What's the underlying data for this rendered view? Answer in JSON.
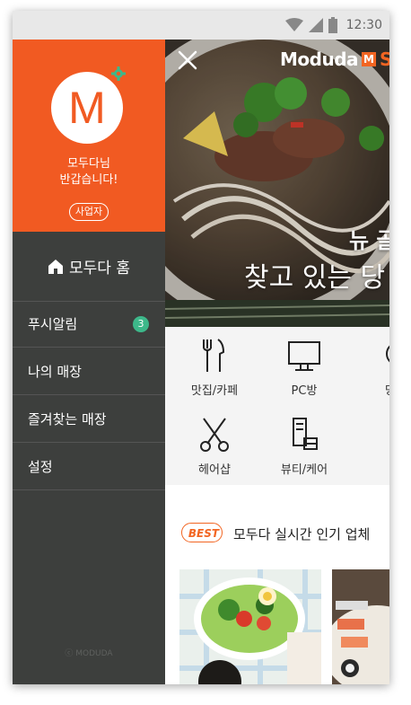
{
  "status_bar": {
    "time": "12:30"
  },
  "drawer": {
    "avatar_letter": "M",
    "greeting_line1": "모두다님",
    "greeting_line2": "반갑습니다!",
    "business_button": "사업자",
    "home_label": "모두다 홈",
    "menu": [
      {
        "label": "푸시알림",
        "badge": "3"
      },
      {
        "label": "나의 매장"
      },
      {
        "label": "즐겨찾는 매장"
      },
      {
        "label": "설정"
      }
    ],
    "copyright": "ⓒ MODUDA"
  },
  "main": {
    "brand": "Moduda",
    "brand_mark": "M",
    "brand_suffix": "S",
    "hero_line1": "뉴 골",
    "hero_line2": "찾고 있는 당",
    "categories": [
      {
        "label": "맛집/카페",
        "icon": "utensils-icon"
      },
      {
        "label": "PC방",
        "icon": "monitor-icon"
      },
      {
        "label": "당",
        "icon": "partial-icon"
      },
      {
        "label": "헤어샵",
        "icon": "scissors-icon"
      },
      {
        "label": "뷰티/케어",
        "icon": "cosmetics-icon"
      }
    ],
    "best_badge": "BEST",
    "best_title": "모두다 실시간 인기 업체"
  },
  "colors": {
    "accent": "#f15a22",
    "drawer_bg": "#3d3f3d",
    "badge": "#3db88a"
  }
}
